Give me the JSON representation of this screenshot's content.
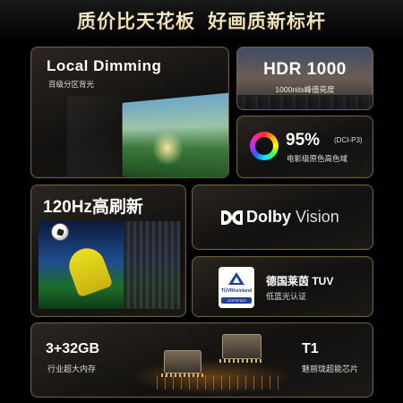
{
  "headline": {
    "left": "质价比天花板",
    "right": "好画质新标杆"
  },
  "local_dimming": {
    "title": "Local Dimming",
    "subtitle": "百级分区背光"
  },
  "hdr": {
    "title": "HDR 1000",
    "subtitle": "1000nits峰值亮度"
  },
  "color_gamut": {
    "value": "95%",
    "standard": "(DCI-P3)",
    "subtitle": "电影级原色高色域"
  },
  "refresh": {
    "title": "120Hz高刷新"
  },
  "dolby": {
    "brand": "Dolby",
    "product": "Vision"
  },
  "tuv": {
    "badge_name": "TÜVRheinland",
    "badge_cert": "CERTIFIED",
    "title": "德国莱茵 TUV",
    "subtitle": "低蓝光认证"
  },
  "memory": {
    "title": "3+32GB",
    "subtitle": "行业超大内存"
  },
  "chip": {
    "title": "T1",
    "subtitle": "魅丽珑超能芯片"
  },
  "colors": {
    "accent_gold": "#e8cf96",
    "border": "#6e5a3c",
    "tuv_blue": "#1f3f99"
  }
}
